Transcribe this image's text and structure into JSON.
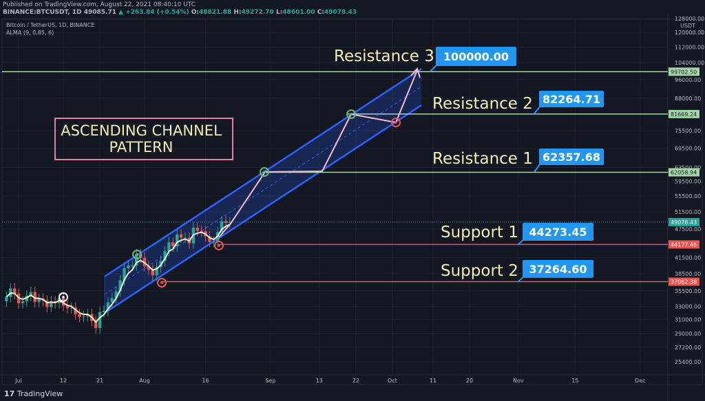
{
  "header": {
    "published": "Published on TradingView.com, August 22, 2021 08:40:10 UTC",
    "symbol": "BINANCE:BTCUSDT, 1D",
    "last": "49085.71",
    "change": "▲ +263.84 (+0.54%)",
    "o_label": "O:",
    "o": "48821.88",
    "h_label": "H:",
    "h": "49272.70",
    "l_label": "L:",
    "l": "48601.00",
    "c_label": "C:",
    "c": "49078.43",
    "legend_title": "Bitcoin / TetherUS, 1D, BINANCE",
    "indicator": "ALMA (9, 0.85, 6)"
  },
  "footer": {
    "brand": "TradingView"
  },
  "colors": {
    "background": "#131722",
    "up": "#26a69a",
    "down": "#ef5350",
    "channel": "#2962ff",
    "resistance": "#a5d6a7",
    "support": "#ef5350",
    "path": "#f8bbd0",
    "label_box": "#2196f3",
    "text": "#f3edb6"
  },
  "chart_data": {
    "type": "candlestick",
    "scale": "log",
    "currency_label": "USDT",
    "ylim": [
      24500,
      130000
    ],
    "y_ticks": [
      "128000.00",
      "120000.00",
      "112000.00",
      "104000.00",
      "96000.00",
      "88000.00",
      "75500.00",
      "69500.00",
      "63500.00",
      "59500.00",
      "55500.00",
      "51500.00",
      "47500.00",
      "41500.00",
      "38500.00",
      "35500.00",
      "33000.00",
      "31000.00",
      "29000.00",
      "27200.00",
      "25400.00"
    ],
    "x_ticks": [
      {
        "label": "Jul",
        "date": "2021-07-01"
      },
      {
        "label": "12",
        "date": "2021-07-12"
      },
      {
        "label": "21",
        "date": "2021-07-21"
      },
      {
        "label": "Aug",
        "date": "2021-08-01"
      },
      {
        "label": "16",
        "date": "2021-08-16"
      },
      {
        "label": "Sep",
        "date": "2021-09-01"
      },
      {
        "label": "13",
        "date": "2021-09-13"
      },
      {
        "label": "22",
        "date": "2021-09-22"
      },
      {
        "label": "Oct",
        "date": "2021-10-01"
      },
      {
        "label": "11",
        "date": "2021-10-11"
      },
      {
        "label": "20",
        "date": "2021-10-20"
      },
      {
        "label": "Nov",
        "date": "2021-11-01"
      },
      {
        "label": "15",
        "date": "2021-11-15"
      },
      {
        "label": "Dec",
        "date": "2021-12-01"
      }
    ],
    "first_candle_date": "2021-06-28",
    "closes": [
      34500,
      35900,
      35000,
      33500,
      33800,
      34700,
      35300,
      33700,
      34200,
      33900,
      32900,
      33800,
      33500,
      34300,
      33100,
      32700,
      32800,
      31800,
      31400,
      31500,
      31800,
      30800,
      29800,
      32100,
      32300,
      33600,
      34300,
      35400,
      37300,
      39500,
      40000,
      40000,
      42200,
      41500,
      39900,
      39200,
      38200,
      39700,
      40900,
      42800,
      44600,
      43800,
      46300,
      45600,
      45600,
      44400,
      47800,
      47100,
      47000,
      45900,
      44700,
      44700,
      46800,
      49300,
      48900,
      49080
    ],
    "price_lines": [
      {
        "value": "99702.50",
        "price": 99702.5,
        "kind": "resistance",
        "start": "2021-08-01"
      },
      {
        "value": "81669.24",
        "price": 81669.24,
        "kind": "resistance",
        "start": "2021-09-20"
      },
      {
        "value": "62058.94",
        "price": 62058.94,
        "kind": "resistance",
        "start": "2021-08-30"
      },
      {
        "value": "49078.43",
        "price": 49078.43,
        "kind": "current"
      },
      {
        "value": "44177.46",
        "price": 44177.46,
        "kind": "support",
        "start": "2021-08-19"
      },
      {
        "value": "37062.38",
        "price": 37062.38,
        "kind": "support",
        "start": "2021-08-05"
      }
    ],
    "annotations": [
      {
        "text": "Resistance 3",
        "value": "100000.00"
      },
      {
        "text": "Resistance 2",
        "value": "82264.71"
      },
      {
        "text": "Resistance 1",
        "value": "62357.68"
      },
      {
        "text": "Support 1",
        "value": "44273.45"
      },
      {
        "text": "Support 2",
        "value": "37264.60"
      }
    ],
    "pattern_title_line1": "ASCENDING CHANNEL",
    "pattern_title_line2": "PATTERN"
  }
}
